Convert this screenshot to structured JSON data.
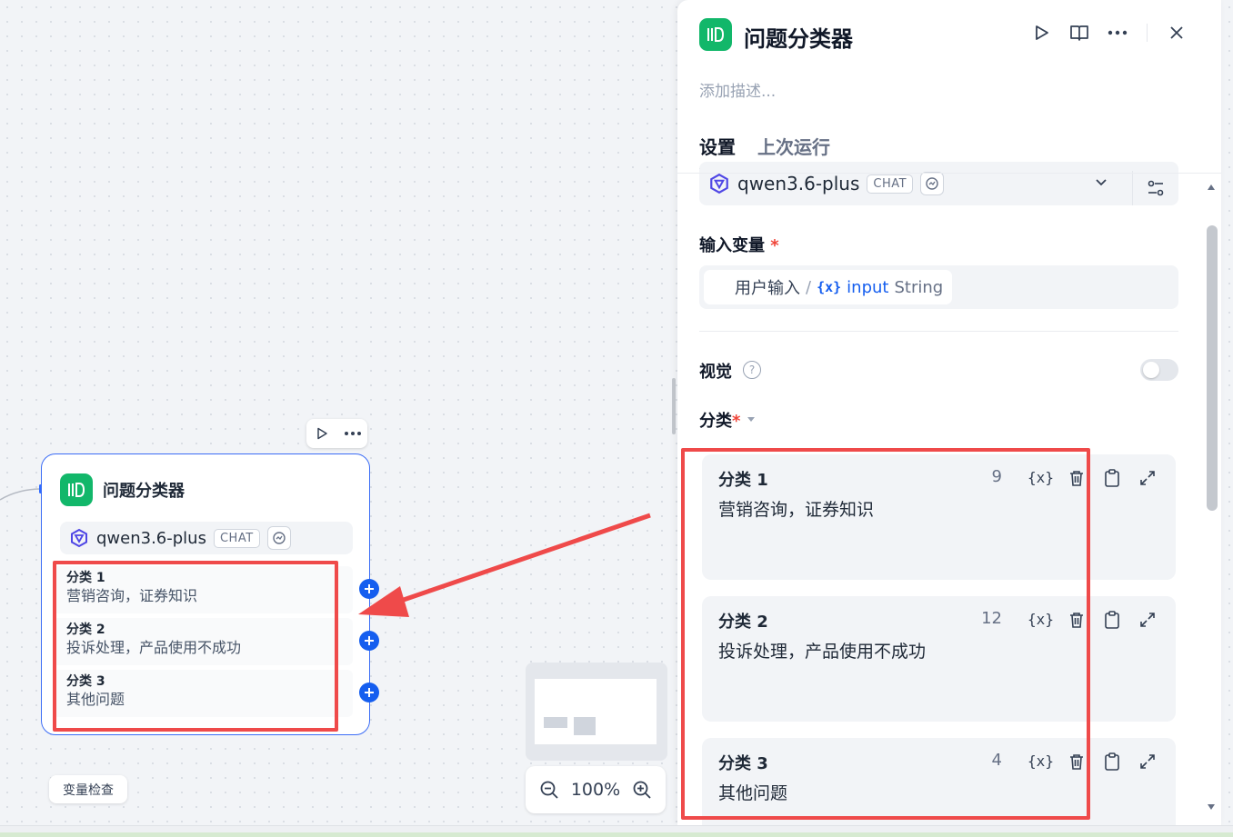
{
  "canvas": {
    "node": {
      "title": "问题分类器",
      "model": "qwen3.6-plus",
      "model_badge": "CHAT",
      "classes": [
        {
          "title": "分类 1",
          "desc": "营销咨询，证券知识"
        },
        {
          "title": "分类 2",
          "desc": "投诉处理，产品使用不成功"
        },
        {
          "title": "分类 3",
          "desc": "其他问题"
        }
      ]
    },
    "var_check_label": "变量检查",
    "zoom": "100%"
  },
  "panel": {
    "title": "问题分类器",
    "description_placeholder": "添加描述...",
    "tabs": [
      "设置",
      "上次运行"
    ],
    "model": "qwen3.6-plus",
    "model_badge": "CHAT",
    "input_label": "输入变量",
    "required_mark": "*",
    "input_var": {
      "source": "用户输入",
      "sep": "/",
      "brace": "{x}",
      "name": "input",
      "type": "String"
    },
    "vision_label": "视觉",
    "vision_help": "?",
    "vision_enabled": false,
    "classes_label": "分类",
    "classes": [
      {
        "title": "分类 1",
        "count": "9",
        "desc": "营销咨询，证券知识"
      },
      {
        "title": "分类 2",
        "count": "12",
        "desc": "投诉处理，产品使用不成功"
      },
      {
        "title": "分类 3",
        "count": "4",
        "desc": "其他问题"
      }
    ],
    "var_icon": "{x}"
  },
  "colors": {
    "accent": "#155eef",
    "node_green": "#12b76a",
    "annotation_red": "#ef4a4a",
    "node_border": "#3b6cf6"
  },
  "icons": [
    "play-icon",
    "book-icon",
    "more-icon",
    "close-icon",
    "chevron-down-icon",
    "settings-sliders-icon",
    "zoom-in-icon",
    "zoom-out-icon",
    "trash-icon",
    "clipboard-icon",
    "expand-icon",
    "help-icon",
    "model-logo-icon",
    "vision-icon"
  ]
}
